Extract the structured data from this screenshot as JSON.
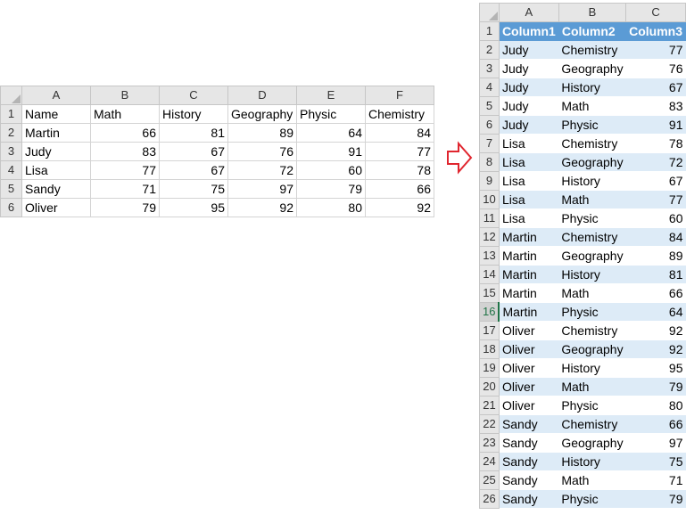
{
  "left_sheet": {
    "col_headers": [
      "A",
      "B",
      "C",
      "D",
      "E",
      "F"
    ],
    "header_row": {
      "num": "1",
      "cells": [
        "Name",
        "Math",
        "History",
        "Geography",
        "Physic",
        "Chemistry"
      ]
    },
    "rows": [
      {
        "num": "2",
        "name": "Martin",
        "values": [
          "66",
          "81",
          "89",
          "64",
          "84"
        ]
      },
      {
        "num": "3",
        "name": "Judy",
        "values": [
          "83",
          "67",
          "76",
          "91",
          "77"
        ]
      },
      {
        "num": "4",
        "name": "Lisa",
        "values": [
          "77",
          "67",
          "72",
          "60",
          "78"
        ]
      },
      {
        "num": "5",
        "name": "Sandy",
        "values": [
          "71",
          "75",
          "97",
          "79",
          "66"
        ]
      },
      {
        "num": "6",
        "name": "Oliver",
        "values": [
          "79",
          "95",
          "92",
          "80",
          "92"
        ]
      }
    ]
  },
  "arrow": {
    "color": "#e0262f"
  },
  "right_sheet": {
    "col_headers": [
      "A",
      "B",
      "C"
    ],
    "header_row": {
      "num": "1",
      "cells": [
        "Column1",
        "Column2",
        "Column3"
      ]
    },
    "active_row": "16",
    "rows": [
      {
        "num": "2",
        "a": "Judy",
        "b": "Chemistry",
        "c": "77"
      },
      {
        "num": "3",
        "a": "Judy",
        "b": "Geography",
        "c": "76"
      },
      {
        "num": "4",
        "a": "Judy",
        "b": "History",
        "c": "67"
      },
      {
        "num": "5",
        "a": "Judy",
        "b": "Math",
        "c": "83"
      },
      {
        "num": "6",
        "a": "Judy",
        "b": "Physic",
        "c": "91"
      },
      {
        "num": "7",
        "a": "Lisa",
        "b": "Chemistry",
        "c": "78"
      },
      {
        "num": "8",
        "a": "Lisa",
        "b": "Geography",
        "c": "72"
      },
      {
        "num": "9",
        "a": "Lisa",
        "b": "History",
        "c": "67"
      },
      {
        "num": "10",
        "a": "Lisa",
        "b": "Math",
        "c": "77"
      },
      {
        "num": "11",
        "a": "Lisa",
        "b": "Physic",
        "c": "60"
      },
      {
        "num": "12",
        "a": "Martin",
        "b": "Chemistry",
        "c": "84"
      },
      {
        "num": "13",
        "a": "Martin",
        "b": "Geography",
        "c": "89"
      },
      {
        "num": "14",
        "a": "Martin",
        "b": "History",
        "c": "81"
      },
      {
        "num": "15",
        "a": "Martin",
        "b": "Math",
        "c": "66"
      },
      {
        "num": "16",
        "a": "Martin",
        "b": "Physic",
        "c": "64"
      },
      {
        "num": "17",
        "a": "Oliver",
        "b": "Chemistry",
        "c": "92"
      },
      {
        "num": "18",
        "a": "Oliver",
        "b": "Geography",
        "c": "92"
      },
      {
        "num": "19",
        "a": "Oliver",
        "b": "History",
        "c": "95"
      },
      {
        "num": "20",
        "a": "Oliver",
        "b": "Math",
        "c": "79"
      },
      {
        "num": "21",
        "a": "Oliver",
        "b": "Physic",
        "c": "80"
      },
      {
        "num": "22",
        "a": "Sandy",
        "b": "Chemistry",
        "c": "66"
      },
      {
        "num": "23",
        "a": "Sandy",
        "b": "Geography",
        "c": "97"
      },
      {
        "num": "24",
        "a": "Sandy",
        "b": "History",
        "c": "75"
      },
      {
        "num": "25",
        "a": "Sandy",
        "b": "Math",
        "c": "71"
      },
      {
        "num": "26",
        "a": "Sandy",
        "b": "Physic",
        "c": "79"
      }
    ]
  }
}
